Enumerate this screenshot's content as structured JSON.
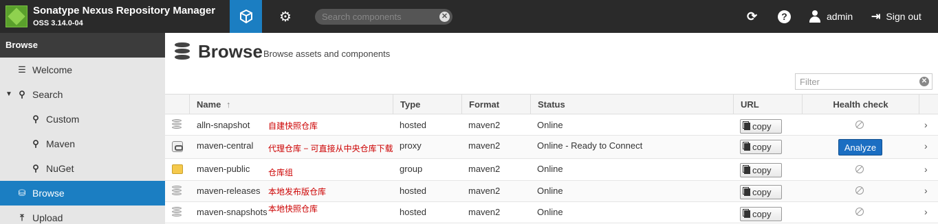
{
  "header": {
    "app_title": "Sonatype Nexus Repository Manager",
    "version": "OSS 3.14.0-04",
    "search_placeholder": "Search components",
    "user": "admin",
    "signout": "Sign out"
  },
  "sidebar": {
    "header": "Browse",
    "items": [
      {
        "label": "Welcome",
        "icon": "list-icon"
      },
      {
        "label": "Search",
        "icon": "search-icon"
      },
      {
        "label": "Custom",
        "icon": "search-icon"
      },
      {
        "label": "Maven",
        "icon": "search-icon"
      },
      {
        "label": "NuGet",
        "icon": "search-icon"
      },
      {
        "label": "Browse",
        "icon": "database-icon",
        "active": true
      },
      {
        "label": "Upload",
        "icon": "upload-icon"
      }
    ]
  },
  "main": {
    "title": "Browse",
    "subtitle": "Browse assets and components",
    "filter_placeholder": "Filter",
    "columns": {
      "name": "Name",
      "type": "Type",
      "format": "Format",
      "status": "Status",
      "url": "URL",
      "health": "Health check"
    },
    "copy_label": "copy",
    "analyze_label": "Analyze",
    "rows": [
      {
        "name": "alln-snapshot",
        "note": "自建快照仓库",
        "type": "hosted",
        "format": "maven2",
        "status": "Online",
        "icon": "hosted-db-icon"
      },
      {
        "name": "maven-central",
        "note": "代理仓库 − 可直接从中央仓库下载",
        "type": "proxy",
        "format": "maven2",
        "status": "Online - Ready to Connect",
        "icon": "proxy-icon"
      },
      {
        "name": "maven-public",
        "note": "仓库组",
        "type": "group",
        "format": "maven2",
        "status": "Online",
        "icon": "group-folder-icon"
      },
      {
        "name": "maven-releases",
        "note": "本地发布版仓库",
        "type": "hosted",
        "format": "maven2",
        "status": "Online",
        "icon": "hosted-db-icon"
      },
      {
        "name": "maven-snapshots",
        "note": "本地快照仓库",
        "type": "hosted",
        "format": "maven2",
        "status": "Online",
        "icon": "hosted-db-icon"
      }
    ]
  }
}
